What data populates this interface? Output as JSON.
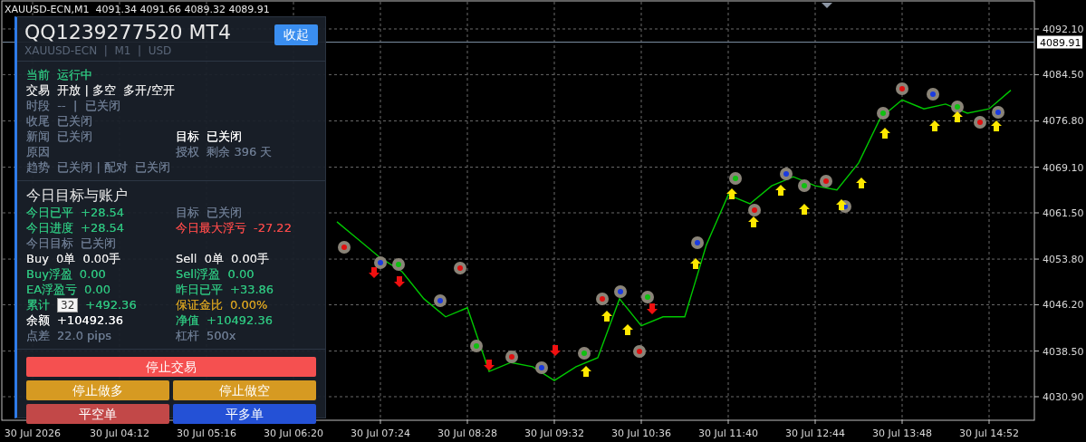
{
  "chart": {
    "header": "XAUUSD-ECN,M1  4091.34 4091.66 4089.32 4089.91",
    "price_label": "4089.91",
    "chart_data": {
      "type": "line",
      "grid": true,
      "categories": [
        "30 Jul 2026",
        null,
        null,
        null,
        "30 Jul 04:12",
        null,
        null,
        null,
        "30 Jul 05:16",
        null,
        null,
        null,
        "30 Jul 06:20",
        null,
        null,
        null,
        "30 Jul 07:24",
        null,
        null,
        null,
        "30 Jul 08:28",
        null,
        null,
        null,
        "30 Jul 09:32",
        null,
        null,
        null,
        "30 Jul 10:36",
        null,
        null,
        null,
        "30 Jul 11:40",
        null,
        null,
        null,
        "30 Jul 12:44",
        null,
        null,
        null,
        "30 Jul 13:48",
        null,
        null,
        null,
        "30 Jul 14:52",
        null
      ],
      "series": [
        {
          "color": "#00c800",
          "values": [
            null,
            null,
            null,
            null,
            null,
            null,
            null,
            null,
            null,
            null,
            null,
            null,
            null,
            null,
            4060.0,
            4057.0,
            4054.0,
            4051.7,
            4047.2,
            4044.2,
            4045.7,
            4035.1,
            4036.6,
            4035.9,
            4033.6,
            4035.9,
            4037.4,
            4047.2,
            4042.7,
            4044.2,
            4044.2,
            4056.2,
            4064.5,
            4063.0,
            4066.0,
            4067.5,
            4066.0,
            4065.3,
            4069.8,
            4077.3,
            4080.3,
            4078.8,
            4079.6,
            4078.1,
            4078.8,
            4081.9
          ]
        }
      ],
      "ylim": [
        4026.83,
        4096.92
      ],
      "yticks": [
        {
          "value": 4092.1,
          "label": "4092.10"
        },
        {
          "value": 4084.5,
          "label": "4084.50"
        },
        {
          "value": 4076.8,
          "label": "4076.80"
        },
        {
          "value": 4069.1,
          "label": "4069.10"
        },
        {
          "value": 4061.5,
          "label": "4061.50"
        },
        {
          "value": 4053.8,
          "label": "4053.80"
        },
        {
          "value": 4046.2,
          "label": "4046.20"
        },
        {
          "value": 4038.5,
          "label": "4038.50"
        },
        {
          "value": 4030.9,
          "label": "4030.90"
        }
      ]
    }
  },
  "panel": {
    "title": "QQ1239277520 MT4",
    "subtitle": "XAUUSD-ECN  |  M1  |  USD",
    "collapse_button": "收起",
    "status_rows": [
      {
        "left": {
          "text": "当前  运行中",
          "color": "#2ec27e"
        }
      },
      {
        "left": {
          "text": "交易  开放 | 多空  多开/空开",
          "color": "#e8e8e8"
        }
      },
      {
        "left": {
          "text": "时段  --  |  已关闭",
          "color": "#6b7a90"
        }
      },
      {
        "left": {
          "text": "收尾  已关闭",
          "color": "#6b7a90"
        }
      },
      {
        "left": {
          "text": "新闻  已关闭",
          "color": "#6b7a90"
        },
        "right": {
          "text": "目标  已关闭",
          "color": "#ffffff"
        }
      },
      {
        "left": {
          "text": "原因",
          "color": "#6b7a90"
        },
        "right": {
          "text": "授权  剩余 396 天",
          "color": "#6b7a90"
        }
      },
      {
        "left": {
          "text": "趋势  已关闭 | 配对  已关闭",
          "color": "#6b7a90"
        }
      }
    ],
    "account_heading": "今日目标与账户",
    "account_rows": [
      {
        "left": {
          "label": "今日已平",
          "value": "+28.54",
          "color": "#2ec27e"
        },
        "right": {
          "label": "目标",
          "value": "已关闭",
          "color": "#6b7a90"
        }
      },
      {
        "left": {
          "label": "今日进度",
          "value": "+28.54",
          "color": "#2ec27e"
        },
        "right": {
          "label": "今日最大浮亏",
          "value": "-27.22",
          "color": "#f04848"
        }
      },
      {
        "left": {
          "label": "今日目标",
          "value": "已关闭",
          "color": "#6b7a90"
        }
      },
      {
        "left": {
          "label": "Buy  0单",
          "value": "0.00手",
          "color": "#e8e8e8"
        },
        "right": {
          "label": "Sell  0单",
          "value": "0.00手",
          "color": "#e8e8e8"
        }
      },
      {
        "left": {
          "label": "Buy浮盈",
          "value": "0.00",
          "color": "#2ec27e"
        },
        "right": {
          "label": "Sell浮盈",
          "value": "0.00",
          "color": "#2ec27e"
        }
      },
      {
        "left": {
          "label": "EA浮盈亏",
          "value": "0.00",
          "color": "#2ec27e"
        },
        "right": {
          "label": "昨日已平",
          "value": "+33.86",
          "color": "#2ec27e"
        }
      },
      {
        "left": {
          "label": "累计",
          "tooltip": "32",
          "value": "+492.36",
          "color": "#2ec27e"
        },
        "right": {
          "label": "保证金比",
          "value": "0.00%",
          "color": "#d4a020"
        }
      },
      {
        "left": {
          "label": "余额",
          "value": "+10492.36",
          "color": "#ffffff"
        },
        "right": {
          "label": "净值",
          "value": "+10492.36",
          "color": "#2ec27e"
        }
      },
      {
        "left": {
          "label": "点差",
          "value": "22.0 pips",
          "color": "#6b7a90"
        },
        "right": {
          "label": "杠杆",
          "value": "500x",
          "color": "#6b7a90"
        }
      }
    ],
    "buttons": [
      {
        "label": "停止交易",
        "kind": "wide",
        "color": "#f55050"
      },
      {
        "label": "停止做多",
        "kind": "half",
        "color": "#d69a22"
      },
      {
        "label": "停止做空",
        "kind": "half",
        "color": "#d69a22"
      },
      {
        "label": "平空单",
        "kind": "half",
        "color": "#c24848"
      },
      {
        "label": "平多单",
        "kind": "half",
        "color": "#2451d6"
      }
    ]
  }
}
